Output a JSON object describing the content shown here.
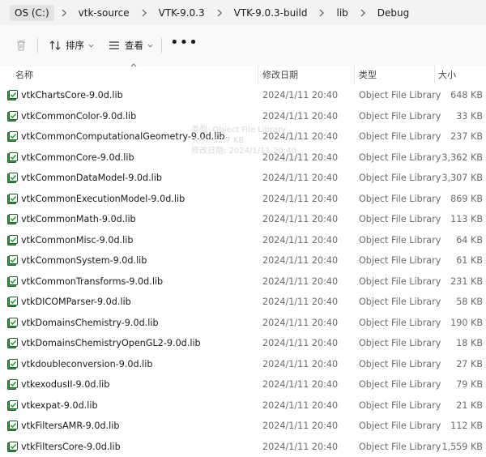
{
  "breadcrumb": [
    "OS (C:)",
    "vtk-source",
    "VTK-9.0.3",
    "VTK-9.0.3-build",
    "lib",
    "Debug"
  ],
  "toolbar": {
    "sort_label": "排序",
    "view_label": "查看",
    "more_label": "•••"
  },
  "columns": {
    "name": "名称",
    "date": "修改日期",
    "type": "类型",
    "size": "大小"
  },
  "tooltip": {
    "line1": "类型: Object File Library",
    "line2": "大小: 32.7 KB",
    "line3": "修改日期: 2024/1/11 20:40"
  },
  "colors": {
    "icon_green": "#2f9a3a",
    "icon_dark": "#1f5e27",
    "text_gray": "#6b6b6b"
  },
  "files": [
    {
      "name": "vtkChartsCore-9.0d.lib",
      "date": "2024/1/11 20:40",
      "type": "Object File Library",
      "size": "648 KB"
    },
    {
      "name": "vtkCommonColor-9.0d.lib",
      "date": "2024/1/11 20:40",
      "type": "Object File Library",
      "size": "33 KB"
    },
    {
      "name": "vtkCommonComputationalGeometry-9.0d.lib",
      "date": "2024/1/11 20:40",
      "type": "Object File Library",
      "size": "237 KB"
    },
    {
      "name": "vtkCommonCore-9.0d.lib",
      "date": "2024/1/11 20:40",
      "type": "Object File Library",
      "size": "3,362 KB"
    },
    {
      "name": "vtkCommonDataModel-9.0d.lib",
      "date": "2024/1/11 20:40",
      "type": "Object File Library",
      "size": "3,307 KB"
    },
    {
      "name": "vtkCommonExecutionModel-9.0d.lib",
      "date": "2024/1/11 20:40",
      "type": "Object File Library",
      "size": "869 KB"
    },
    {
      "name": "vtkCommonMath-9.0d.lib",
      "date": "2024/1/11 20:40",
      "type": "Object File Library",
      "size": "113 KB"
    },
    {
      "name": "vtkCommonMisc-9.0d.lib",
      "date": "2024/1/11 20:40",
      "type": "Object File Library",
      "size": "64 KB"
    },
    {
      "name": "vtkCommonSystem-9.0d.lib",
      "date": "2024/1/11 20:40",
      "type": "Object File Library",
      "size": "61 KB"
    },
    {
      "name": "vtkCommonTransforms-9.0d.lib",
      "date": "2024/1/11 20:40",
      "type": "Object File Library",
      "size": "231 KB"
    },
    {
      "name": "vtkDICOMParser-9.0d.lib",
      "date": "2024/1/11 20:40",
      "type": "Object File Library",
      "size": "58 KB"
    },
    {
      "name": "vtkDomainsChemistry-9.0d.lib",
      "date": "2024/1/11 20:40",
      "type": "Object File Library",
      "size": "190 KB"
    },
    {
      "name": "vtkDomainsChemistryOpenGL2-9.0d.lib",
      "date": "2024/1/11 20:40",
      "type": "Object File Library",
      "size": "18 KB"
    },
    {
      "name": "vtkdoubleconversion-9.0d.lib",
      "date": "2024/1/11 20:40",
      "type": "Object File Library",
      "size": "27 KB"
    },
    {
      "name": "vtkexodusII-9.0d.lib",
      "date": "2024/1/11 20:40",
      "type": "Object File Library",
      "size": "79 KB"
    },
    {
      "name": "vtkexpat-9.0d.lib",
      "date": "2024/1/11 20:40",
      "type": "Object File Library",
      "size": "21 KB"
    },
    {
      "name": "vtkFiltersAMR-9.0d.lib",
      "date": "2024/1/11 20:40",
      "type": "Object File Library",
      "size": "112 KB"
    },
    {
      "name": "vtkFiltersCore-9.0d.lib",
      "date": "2024/1/11 20:40",
      "type": "Object File Library",
      "size": "1,559 KB"
    }
  ]
}
